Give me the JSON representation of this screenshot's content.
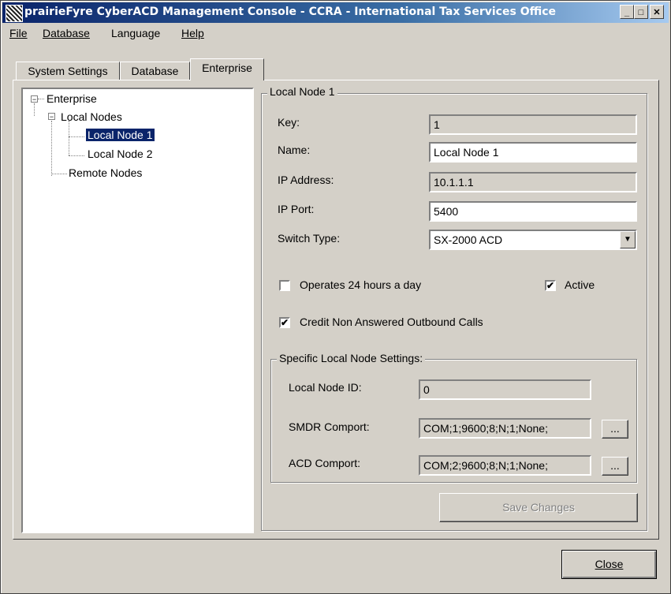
{
  "window": {
    "title": "prairieFyre CyberACD Management Console - CCRA - International Tax Services Office",
    "minimize_glyph": "_",
    "maximize_glyph": "□",
    "close_glyph": "✕"
  },
  "menu": {
    "file": "File",
    "database": "Database",
    "language": "Language",
    "help": "Help"
  },
  "tabs": {
    "system_settings": "System Settings",
    "database": "Database",
    "enterprise": "Enterprise",
    "active": "Enterprise"
  },
  "tree": {
    "root": "Enterprise",
    "local_nodes": "Local Nodes",
    "local_node_1": "Local Node 1",
    "local_node_2": "Local Node 2",
    "remote_nodes": "Remote Nodes",
    "selected": "Local Node 1"
  },
  "node_panel": {
    "group_title": "Local Node 1",
    "key_label": "Key:",
    "key_value": "1",
    "name_label": "Name:",
    "name_value": "Local Node 1",
    "ip_address_label": "IP Address:",
    "ip_address_value": "10.1.1.1",
    "ip_port_label": "IP Port:",
    "ip_port_value": "5400",
    "switch_type_label": "Switch Type:",
    "switch_type_value": "SX-2000 ACD",
    "operates_24h_label": "Operates 24 hours a day",
    "operates_24h_checked": false,
    "active_label": "Active",
    "active_checked": true,
    "credit_label": "Credit Non Answered Outbound Calls",
    "credit_checked": true
  },
  "specific_settings": {
    "group_title": "Specific Local Node Settings:",
    "local_node_id_label": "Local Node ID:",
    "local_node_id_value": "0",
    "smdr_label": "SMDR Comport:",
    "smdr_value": "COM;1;9600;8;N;1;None;",
    "acd_label": "ACD Comport:",
    "acd_value": "COM;2;9600;8;N;1;None;",
    "browse_label": "..."
  },
  "buttons": {
    "save_changes": "Save Changes",
    "close": "Close"
  },
  "glyphs": {
    "check": "✔",
    "dropdown_arrow": "▼",
    "expander_minus": "−"
  }
}
